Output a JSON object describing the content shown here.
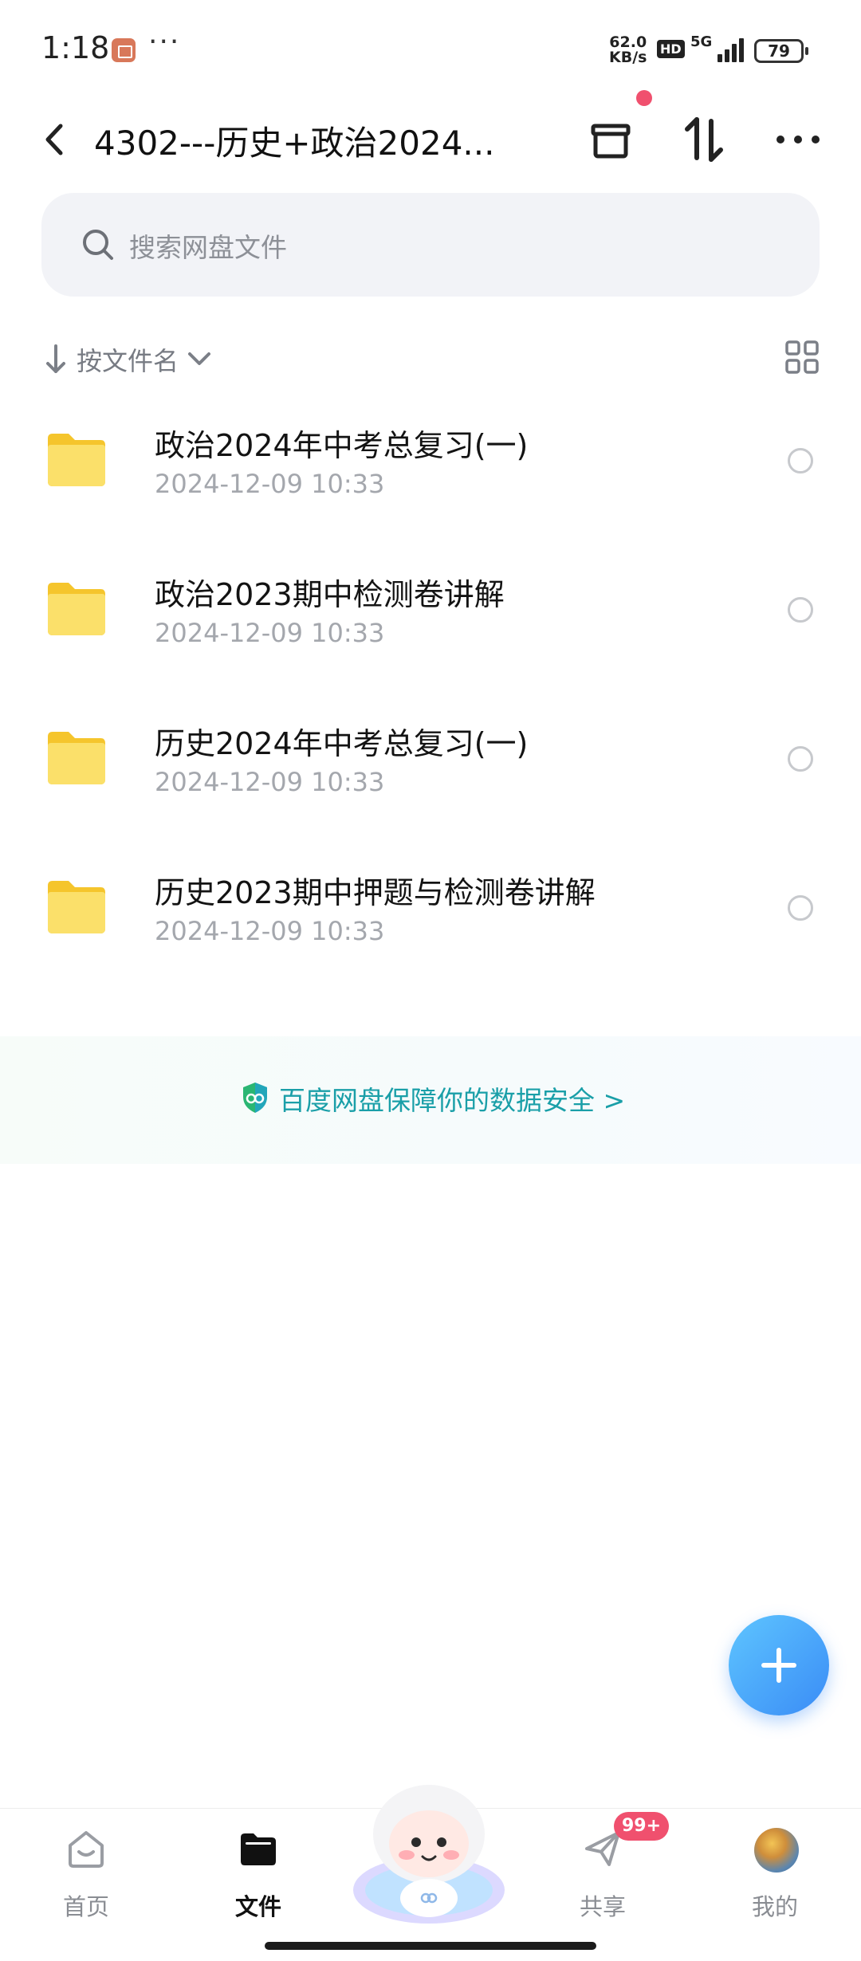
{
  "status_bar": {
    "time": "1:18",
    "dots": "···",
    "net_speed_value": "62.0",
    "net_speed_unit": "KB/s",
    "hd": "HD",
    "network_type": "5G",
    "battery": "79"
  },
  "header": {
    "title": "4302---历史+政治2024..."
  },
  "search": {
    "placeholder": "搜索网盘文件"
  },
  "sort": {
    "label": "按文件名"
  },
  "files": [
    {
      "name": "政治2024年中考总复习(一)",
      "date": "2024-12-09  10:33"
    },
    {
      "name": "政治2023期中检测卷讲解",
      "date": "2024-12-09  10:33"
    },
    {
      "name": "历史2024年中考总复习(一)",
      "date": "2024-12-09  10:33"
    },
    {
      "name": "历史2023期中押题与检测卷讲解",
      "date": "2024-12-09  10:33"
    }
  ],
  "security_banner": {
    "text": "百度网盘保障你的数据安全 >"
  },
  "bottom_nav": {
    "items": [
      {
        "label": "首页",
        "icon": "home-icon"
      },
      {
        "label": "文件",
        "icon": "folder-icon",
        "active": true
      },
      {
        "label": "共享",
        "icon": "share-icon",
        "badge": "99+"
      },
      {
        "label": "我的",
        "icon": "avatar"
      }
    ]
  },
  "colors": {
    "accent": "#3a8cf6",
    "badge": "#f0506e",
    "security_text": "#1a9fa8",
    "folder": "#f7cf3a"
  }
}
